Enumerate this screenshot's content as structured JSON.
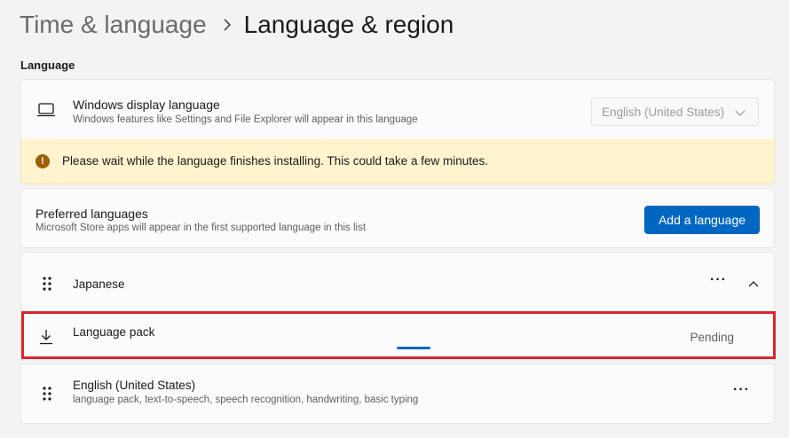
{
  "header": {
    "parent": "Time & language",
    "current": "Language & region"
  },
  "section": {
    "title": "Language"
  },
  "display_language": {
    "title": "Windows display language",
    "subtitle": "Windows features like Settings and File Explorer will appear in this language",
    "dropdown_value": "English (United States)",
    "icon": "laptop-icon"
  },
  "warning": {
    "icon": "info-warning-icon",
    "text": "Please wait while the language finishes installing. This could take a few minutes."
  },
  "preferred": {
    "title": "Preferred languages",
    "subtitle": "Microsoft Store apps will appear in the first supported language in this list",
    "add_button": "Add a language"
  },
  "languages": [
    {
      "name": "Japanese",
      "more": "···",
      "expanded": true,
      "sub_items": [
        {
          "label": "Language pack",
          "status": "Pending",
          "progress": 0.1,
          "icon": "download-icon"
        }
      ]
    },
    {
      "name": "English (United States)",
      "features": "language pack, text-to-speech, speech recognition, handwriting, basic typing",
      "more": "···"
    }
  ],
  "colors": {
    "accent": "#0067c0",
    "warning_bg": "#fff4ce",
    "highlight": "#d9262c"
  }
}
